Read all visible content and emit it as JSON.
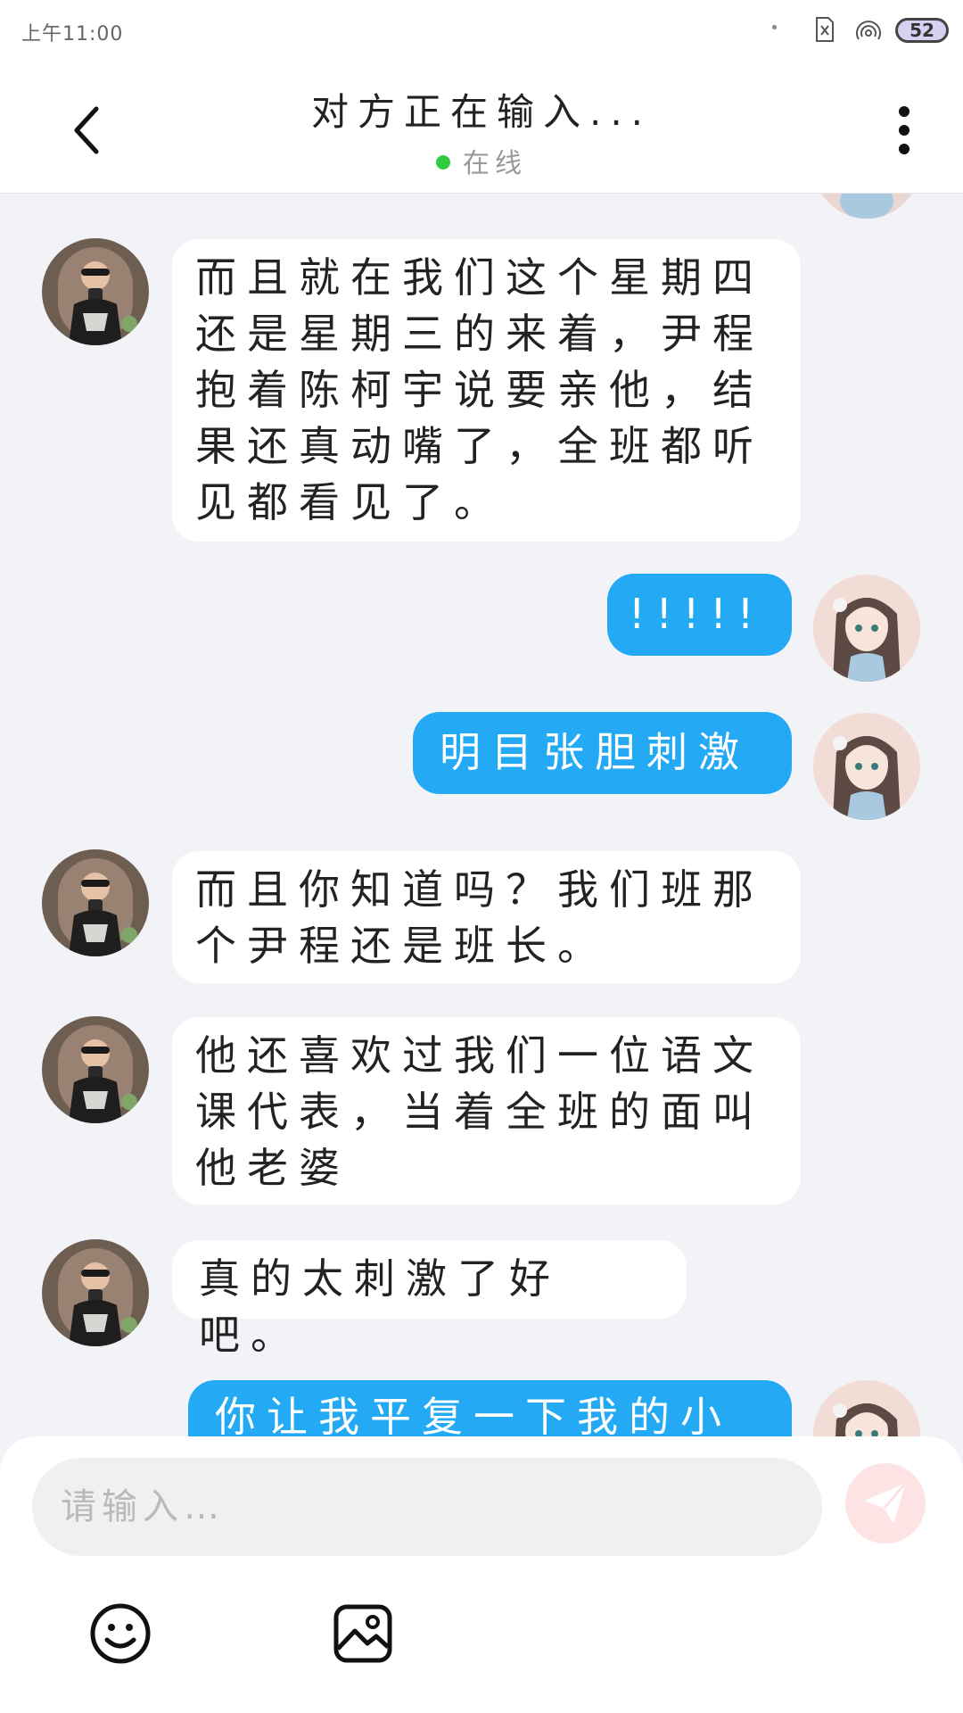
{
  "status_bar": {
    "time": "上午11:00",
    "battery": "52"
  },
  "header": {
    "title": "对方正在输入...",
    "status": "在线"
  },
  "messages": [
    {
      "side": "in",
      "text": "而且就在我们这个星期四还是星期三的来着，尹程抱着陈柯宇说要亲他，结果还真动嘴了，全班都听见都看见了。"
    },
    {
      "side": "out",
      "text": "!!!!!"
    },
    {
      "side": "out",
      "text": "明目张胆刺激"
    },
    {
      "side": "in",
      "text": "而且你知道吗？我们班那个尹程还是班长。"
    },
    {
      "side": "in",
      "text": "他还喜欢过我们一位语文课代表，当着全班的面叫他老婆"
    },
    {
      "side": "in",
      "text": "真的太刺激了好吧。"
    },
    {
      "side": "out",
      "text": "你让我平复一下我的小"
    }
  ],
  "composer": {
    "placeholder": "请输入…"
  },
  "icons": {
    "back": "back-arrow-icon",
    "more": "more-vertical-icon",
    "send": "send-icon",
    "emoji": "emoji-icon",
    "image": "image-icon"
  },
  "colors": {
    "outgoing_bubble": "#24aaf4",
    "online_dot": "#2ecc40"
  }
}
